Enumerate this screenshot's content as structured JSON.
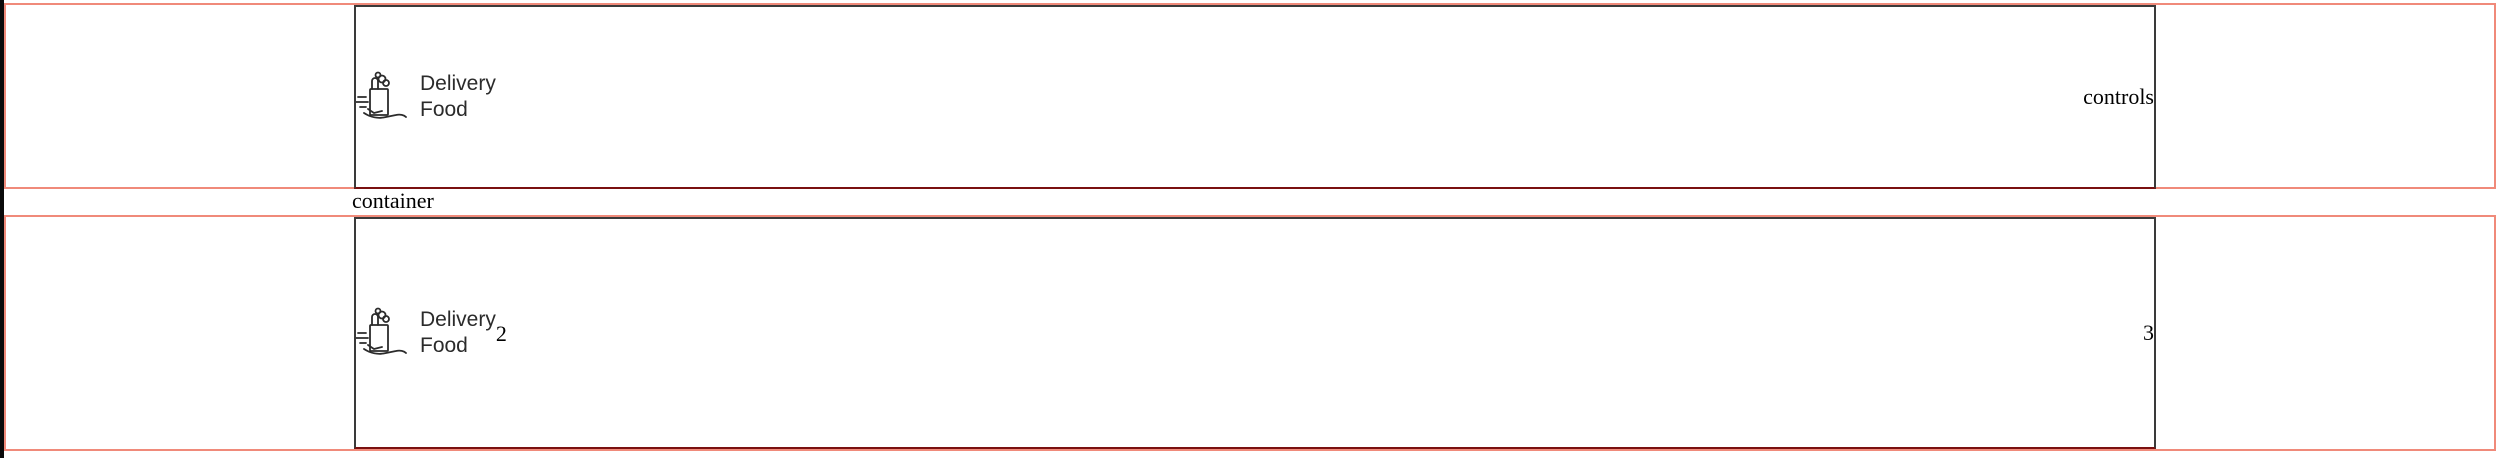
{
  "header": {
    "logo": {
      "icon": "food-bag-delivery-icon",
      "line1": "Delivery",
      "line2": "Food"
    },
    "controls_label": "controls"
  },
  "container_label": "container",
  "section2": {
    "logo": {
      "icon": "food-bag-delivery-icon",
      "line1": "Delivery",
      "line2": "Food"
    },
    "left_item": "2",
    "right_item": "3"
  },
  "colors": {
    "outline_outer": "#f08a7a",
    "outline_inner": "#3a3a3a",
    "rail": "#0a0a0a"
  }
}
